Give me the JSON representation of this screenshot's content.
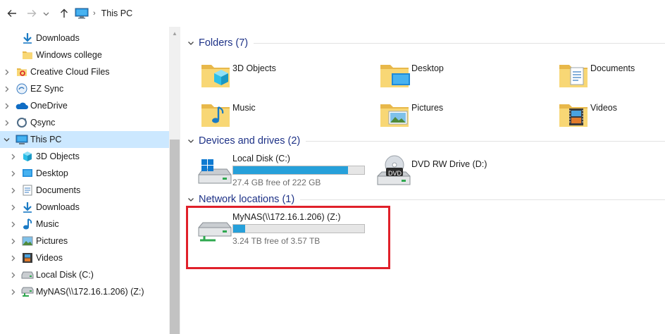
{
  "address": {
    "back_icon": "arrow-left-icon",
    "forward_icon": "arrow-right-icon",
    "recent_icon": "chevron-down-icon",
    "up_icon": "arrow-up-icon",
    "path": "This PC"
  },
  "sidebar": {
    "items": [
      {
        "label": "Downloads",
        "icon": "downloads-icon",
        "indent": 1,
        "chevron": false
      },
      {
        "label": "Windows college",
        "icon": "folder-icon",
        "indent": 1,
        "chevron": false
      },
      {
        "label": "Creative Cloud Files",
        "icon": "creative-cloud-icon",
        "indent": 0,
        "chevron": true
      },
      {
        "label": "EZ Sync",
        "icon": "ez-sync-icon",
        "indent": 0,
        "chevron": true
      },
      {
        "label": "OneDrive",
        "icon": "onedrive-icon",
        "indent": 0,
        "chevron": true
      },
      {
        "label": "Qsync",
        "icon": "qsync-icon",
        "indent": 0,
        "chevron": true
      },
      {
        "label": "This PC",
        "icon": "this-pc-icon",
        "indent": 0,
        "chevron": true,
        "expanded": true,
        "selected": true
      },
      {
        "label": "3D Objects",
        "icon": "3d-objects-icon",
        "indent": 1,
        "chevron": true
      },
      {
        "label": "Desktop",
        "icon": "desktop-icon",
        "indent": 1,
        "chevron": true
      },
      {
        "label": "Documents",
        "icon": "documents-icon",
        "indent": 1,
        "chevron": true
      },
      {
        "label": "Downloads",
        "icon": "downloads-icon",
        "indent": 1,
        "chevron": true
      },
      {
        "label": "Music",
        "icon": "music-icon",
        "indent": 1,
        "chevron": true
      },
      {
        "label": "Pictures",
        "icon": "pictures-icon",
        "indent": 1,
        "chevron": true
      },
      {
        "label": "Videos",
        "icon": "videos-icon",
        "indent": 1,
        "chevron": true
      },
      {
        "label": "Local Disk (C:)",
        "icon": "local-disk-icon",
        "indent": 1,
        "chevron": true
      },
      {
        "label": "MyNAS(\\\\172.16.1.206) (Z:)",
        "icon": "network-drive-icon",
        "indent": 1,
        "chevron": true
      }
    ]
  },
  "main": {
    "folders": {
      "title": "Folders (7)",
      "items": [
        {
          "label": "3D Objects",
          "icon": "3d-objects-folder-icon"
        },
        {
          "label": "Desktop",
          "icon": "desktop-folder-icon"
        },
        {
          "label": "Documents",
          "icon": "documents-folder-icon"
        },
        {
          "label": "Music",
          "icon": "music-folder-icon"
        },
        {
          "label": "Pictures",
          "icon": "pictures-folder-icon"
        },
        {
          "label": "Videos",
          "icon": "videos-folder-icon"
        }
      ]
    },
    "devices": {
      "title": "Devices and drives (2)",
      "items": [
        {
          "name": "Local Disk (C:)",
          "free": "27.4 GB free of 222 GB",
          "used_fraction": 0.877,
          "icon": "local-disk-icon"
        },
        {
          "name": "DVD RW Drive (D:)",
          "icon": "dvd-drive-icon",
          "badge": "DVD"
        }
      ]
    },
    "network": {
      "title": "Network locations (1)",
      "items": [
        {
          "name": "MyNAS(\\\\172.16.1.206) (Z:)",
          "free": "3.24 TB free of 3.57 TB",
          "used_fraction": 0.092,
          "icon": "network-drive-icon"
        }
      ]
    }
  },
  "colors": {
    "accent": "#26a0da",
    "selected_bg": "#cce8ff",
    "group_title": "#1e3287",
    "highlight": "#e0202a"
  }
}
